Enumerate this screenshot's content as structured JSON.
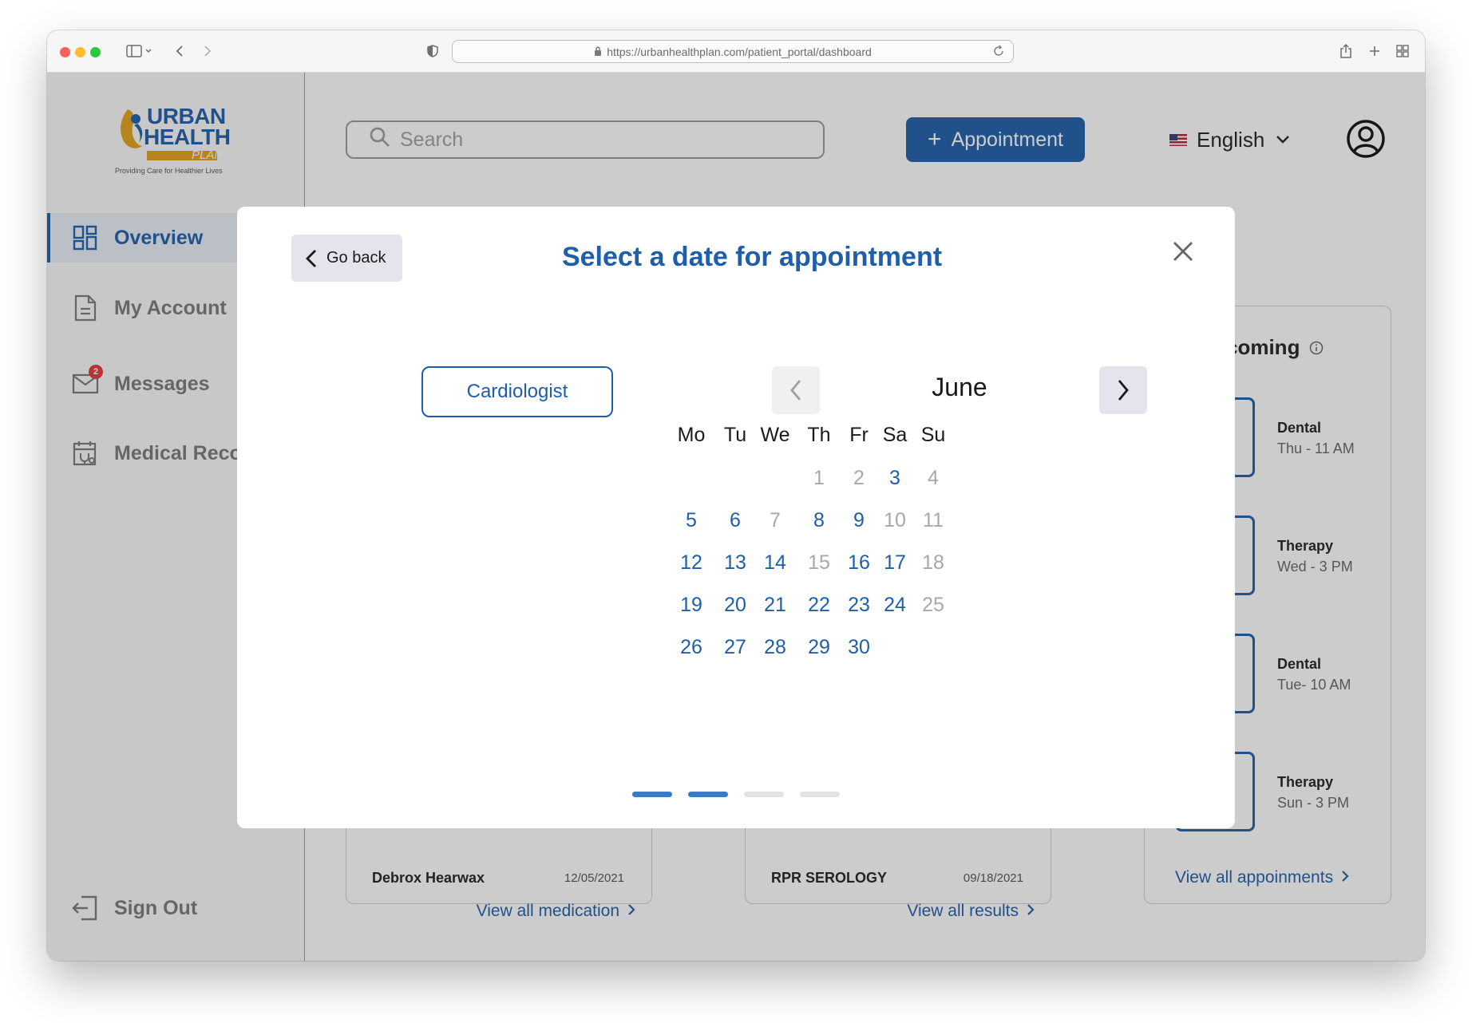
{
  "browser": {
    "url": "https://urbanhealthplan.com/patient_portal/dashboard"
  },
  "brand": {
    "logo_line1": "URBAN",
    "logo_line2": "HEALTH",
    "logo_line3": "PLAN",
    "tagline": "Providing Care for Healthier Lives",
    "primary_color": "#1f5ea8",
    "accent_color": "#e3a21a"
  },
  "sidebar": {
    "items": [
      {
        "label": "Overview",
        "icon": "dashboard-icon",
        "active": true
      },
      {
        "label": "My Account",
        "icon": "document-icon"
      },
      {
        "label": "Messages",
        "icon": "mail-icon",
        "badge": "2"
      },
      {
        "label": "Medical Reco",
        "icon": "medical-calendar-icon"
      }
    ],
    "sign_out": "Sign Out"
  },
  "header": {
    "search_placeholder": "Search",
    "appointment_button": "Appointment",
    "language": "English"
  },
  "upcoming": {
    "title": "coming",
    "items": [
      {
        "type": "Dental",
        "time": "Thu - 11 AM"
      },
      {
        "type": "Therapy",
        "time": "Wed - 3 PM"
      },
      {
        "type": "Dental",
        "time": "Tue- 10 AM"
      },
      {
        "type": "Therapy",
        "time": "Sun - 3 PM"
      }
    ],
    "view_all": "View all appoinments"
  },
  "cards": [
    {
      "name": "Debrox Hearwax",
      "date": "12/05/2021",
      "link": "View all medication"
    },
    {
      "name": "RPR SEROLOGY",
      "date": "09/18/2021",
      "link": "View all results"
    }
  ],
  "modal": {
    "go_back": "Go back",
    "title": "Select a date for appointment",
    "specialty": "Cardiologist",
    "calendar": {
      "month": "June",
      "weekdays": [
        "Mo",
        "Tu",
        "We",
        "Th",
        "Fr",
        "Sa",
        "Su"
      ],
      "days": [
        {
          "d": "1",
          "available": false
        },
        {
          "d": "2",
          "available": false
        },
        {
          "d": "3",
          "available": true
        },
        {
          "d": "4",
          "available": false
        },
        {
          "d": "5",
          "available": true
        },
        {
          "d": "6",
          "available": true
        },
        {
          "d": "7",
          "available": false
        },
        {
          "d": "8",
          "available": true
        },
        {
          "d": "9",
          "available": true
        },
        {
          "d": "10",
          "available": false
        },
        {
          "d": "11",
          "available": false
        },
        {
          "d": "12",
          "available": true
        },
        {
          "d": "13",
          "available": true
        },
        {
          "d": "14",
          "available": true
        },
        {
          "d": "15",
          "available": false
        },
        {
          "d": "16",
          "available": true
        },
        {
          "d": "17",
          "available": true
        },
        {
          "d": "18",
          "available": false
        },
        {
          "d": "19",
          "available": true
        },
        {
          "d": "20",
          "available": true
        },
        {
          "d": "21",
          "available": true
        },
        {
          "d": "22",
          "available": true
        },
        {
          "d": "23",
          "available": true
        },
        {
          "d": "24",
          "available": true
        },
        {
          "d": "25",
          "available": false
        },
        {
          "d": "26",
          "available": true
        },
        {
          "d": "27",
          "available": true
        },
        {
          "d": "28",
          "available": true
        },
        {
          "d": "29",
          "available": true
        },
        {
          "d": "30",
          "available": true
        }
      ]
    },
    "steps_total": 4,
    "step_current": 2
  }
}
